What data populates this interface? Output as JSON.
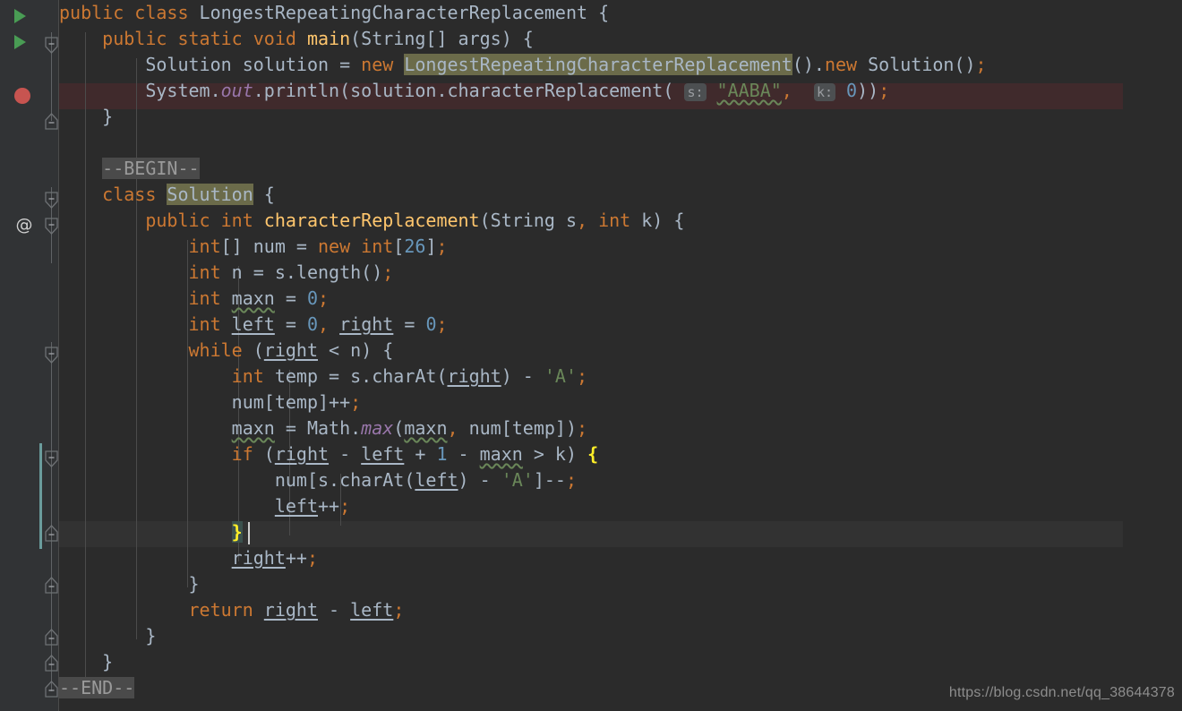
{
  "editor": {
    "theme": "Darcula",
    "language": "Java",
    "font_size_px": 20,
    "line_height_px": 29,
    "colors": {
      "background": "#2b2b2b",
      "gutter_background": "#313335",
      "foreground": "#a9b7c6",
      "keyword": "#cc7832",
      "method": "#ffc66d",
      "number": "#6897bb",
      "string": "#6a8759",
      "static_field": "#9876aa",
      "breakpoint_line": "#402a2c",
      "caret_line": "#323232",
      "identifier_highlight": "#6b6b4a",
      "fold_highlight": "#4a4a4a",
      "brace_match_bg": "#3b514d",
      "brace_match_fg": "#ffef28",
      "run_marker": "#499c54",
      "breakpoint_dot": "#c75450",
      "vcs_changed": "#6a9c9c",
      "indent_guide": "#4b4b4b"
    }
  },
  "gutter": {
    "run_markers": [
      {
        "name": "run-class-marker",
        "line": 1
      },
      {
        "name": "run-main-marker",
        "line": 2
      }
    ],
    "breakpoint": {
      "name": "line-breakpoint",
      "line": 4
    },
    "annotation_marker": {
      "glyph": "@",
      "line": 9
    },
    "fold_markers": [
      {
        "line": 2,
        "dir": "down"
      },
      {
        "line": 5,
        "dir": "up"
      },
      {
        "line": 8,
        "dir": "down"
      },
      {
        "line": 9,
        "dir": "down"
      },
      {
        "line": 14,
        "dir": "down"
      },
      {
        "line": 18,
        "dir": "down"
      },
      {
        "line": 21,
        "dir": "up"
      },
      {
        "line": 23,
        "dir": "up"
      },
      {
        "line": 25,
        "dir": "up"
      },
      {
        "line": 26,
        "dir": "up"
      }
    ]
  },
  "code": {
    "lines": [
      {
        "n": 1,
        "text": "public class LongestRepeatingCharacterReplacement {"
      },
      {
        "n": 2,
        "text": "    public static void main(String[] args) {"
      },
      {
        "n": 3,
        "text": "        Solution solution = new LongestRepeatingCharacterReplacement().new Solution();"
      },
      {
        "n": 4,
        "text": "        System.out.println(solution.characterReplacement( s: \"AABA\",  k: 0));"
      },
      {
        "n": 5,
        "text": "    }"
      },
      {
        "n": 6,
        "text": ""
      },
      {
        "n": 7,
        "text": ""
      },
      {
        "n": 8,
        "text": "    --BEGIN--"
      },
      {
        "n": 9,
        "text": "    class Solution {"
      },
      {
        "n": 10,
        "text": "        public int characterReplacement(String s, int k) {"
      },
      {
        "n": 11,
        "text": "            int[] num = new int[26];"
      },
      {
        "n": 12,
        "text": "            int n = s.length();"
      },
      {
        "n": 13,
        "text": "            int maxn = 0;"
      },
      {
        "n": 14,
        "text": "            int left = 0, right = 0;"
      },
      {
        "n": 15,
        "text": "            while (right < n) {"
      },
      {
        "n": 16,
        "text": "                int temp = s.charAt(right) - 'A';"
      },
      {
        "n": 17,
        "text": "                num[temp]++;"
      },
      {
        "n": 18,
        "text": "                maxn = Math.max(maxn, num[temp]);"
      },
      {
        "n": 19,
        "text": "                if (right - left + 1 - maxn > k) {"
      },
      {
        "n": 20,
        "text": "                    num[s.charAt(left) - 'A']--;"
      },
      {
        "n": 21,
        "text": "                    left++;"
      },
      {
        "n": 22,
        "text": "                }"
      },
      {
        "n": 23,
        "text": "                right++;"
      },
      {
        "n": 24,
        "text": "            }"
      },
      {
        "n": 25,
        "text": "            return right - left;"
      },
      {
        "n": 26,
        "text": "        }"
      },
      {
        "n": 27,
        "text": "    }"
      },
      {
        "n": 28,
        "text": "--END--"
      }
    ],
    "parameter_hints": [
      {
        "label": "s:",
        "line": 4
      },
      {
        "label": "k:",
        "line": 4
      }
    ],
    "fold_placeholders": [
      {
        "label": "--BEGIN--",
        "line": 8
      },
      {
        "label": "--END--",
        "line": 28
      }
    ],
    "highlighted_identifier": "Solution",
    "matched_braces": [
      {
        "char": "{",
        "line": 19
      },
      {
        "char": "}",
        "line": 22
      }
    ],
    "caret": {
      "line": 22,
      "column": 17
    },
    "typo_warnings": [
      "maxn",
      "AABA"
    ]
  },
  "watermark": {
    "text": "https://blog.csdn.net/qq_38644378"
  }
}
